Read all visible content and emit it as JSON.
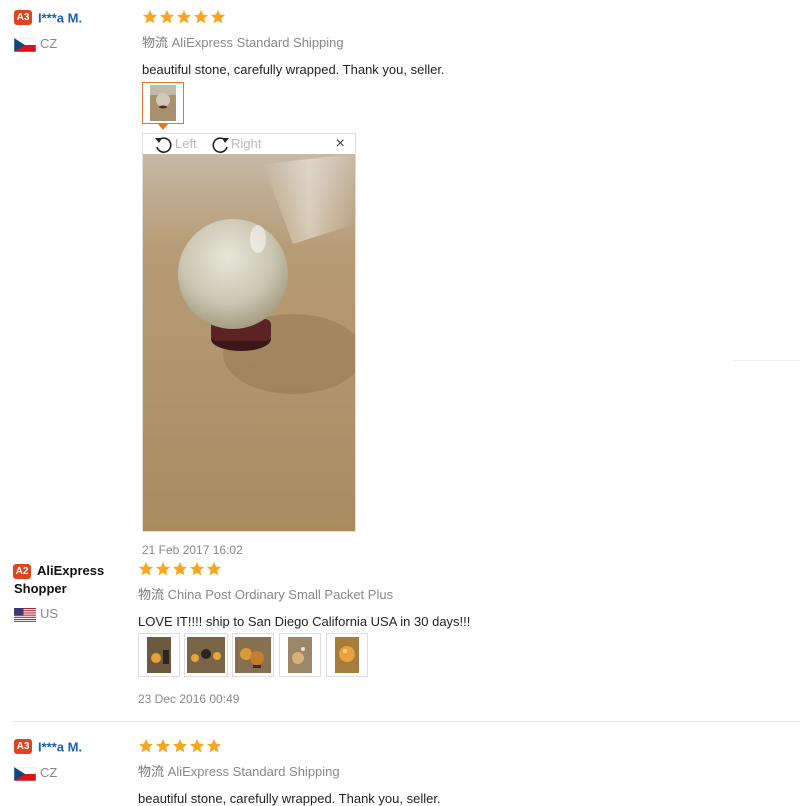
{
  "reviews": [
    {
      "badge": "A3",
      "name": "I***a M.",
      "country": "CZ",
      "shipping_cn": "物流",
      "shipping": "AliExpress Standard Shipping",
      "text": "beautiful stone, carefully wrapped. Thank you, seller.",
      "date": "21 Feb 2017 16:02"
    },
    {
      "badge": "A2",
      "name": "AliExpress Shopper",
      "country": "US",
      "shipping_cn": "物流",
      "shipping": "China Post Ordinary Small Packet Plus",
      "text": "LOVE IT!!!! ship to San Diego California USA in 30 days!!!",
      "date": "23 Dec 2016 00:49"
    },
    {
      "badge": "A3",
      "name": "I***a M.",
      "country": "CZ",
      "shipping_cn": "物流",
      "shipping": "AliExpress Standard Shipping",
      "text": "beautiful stone, carefully wrapped. Thank you, seller."
    }
  ],
  "viewer": {
    "rotate_left": "Left",
    "rotate_right": "Right",
    "close": "×"
  },
  "colors": {
    "star": "#f5a623",
    "badge": "#e0431d",
    "username": "#1a5fb4",
    "active_thumb_border": "#e07b25"
  },
  "icons": [
    "star-icon",
    "rotate-left-icon",
    "rotate-right-icon",
    "close-icon",
    "flag-cz-icon",
    "flag-us-icon"
  ]
}
